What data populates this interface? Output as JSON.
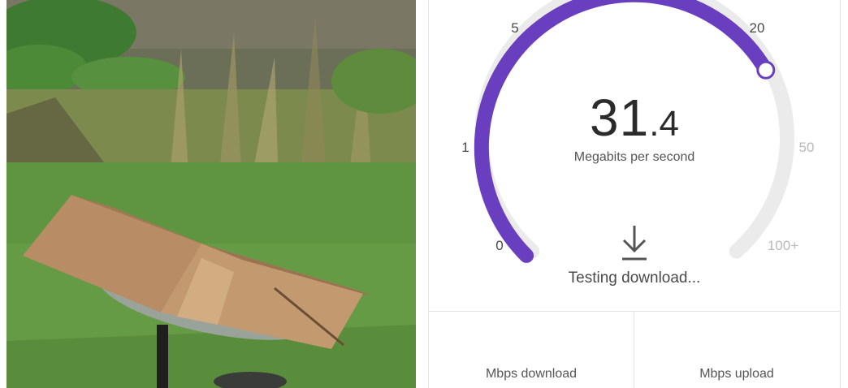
{
  "gauge": {
    "scale_labels": [
      "0",
      "1",
      "5",
      "20",
      "50",
      "100+"
    ],
    "value_integer": "31",
    "value_decimal": ".4",
    "unit": "Megabits per second",
    "status": "Testing download...",
    "progress_fraction": 0.72,
    "accent_color": "#6a3fbf",
    "track_color": "#ebebeb"
  },
  "results": {
    "download_label": "Mbps download",
    "upload_label": "Mbps upload"
  }
}
